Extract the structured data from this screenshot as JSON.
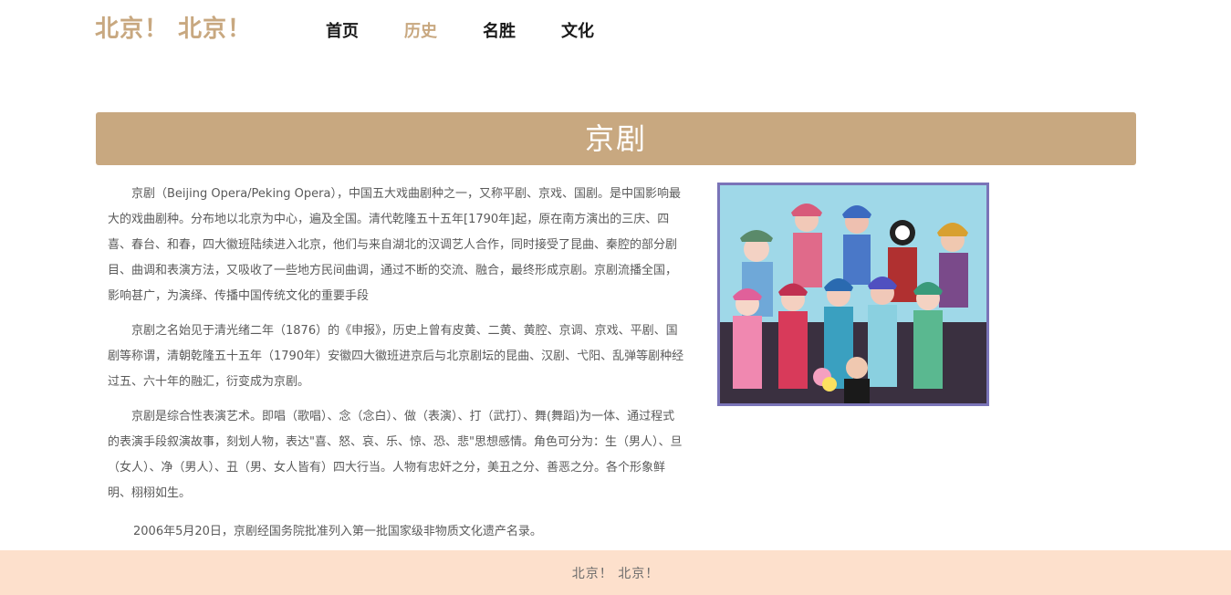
{
  "header": {
    "logo": "北京！ 北京！",
    "nav": [
      {
        "label": "首页",
        "active": false
      },
      {
        "label": "历史",
        "active": true
      },
      {
        "label": "名胜",
        "active": false
      },
      {
        "label": "文化",
        "active": false
      }
    ]
  },
  "main": {
    "title": "京剧",
    "paragraphs": [
      "京剧（Beijing Opera/Peking Opera），中国五大戏曲剧种之一，又称平剧、京戏、国剧。是中国影响最大的戏曲剧种。分布地以北京为中心，遍及全国。清代乾隆五十五年[1790年]起，原在南方演出的三庆、四喜、春台、和春，四大徽班陆续进入北京，他们与来自湖北的汉调艺人合作，同时接受了昆曲、秦腔的部分剧目、曲调和表演方法，又吸收了一些地方民间曲调，通过不断的交流、融合，最终形成京剧。京剧流播全国，影响甚广，为演绎、传播中国传统文化的重要手段",
      "京剧之名始见于清光绪二年（1876）的《申报》，历史上曾有皮黄、二黄、黄腔、京调、京戏、平剧、国剧等称谓，清朝乾隆五十五年（1790年）安徽四大徽班进京后与北京剧坛的昆曲、汉剧、弋阳、乱弹等剧种经过五、六十年的融汇，衍变成为京剧。",
      "京剧是综合性表演艺术。即唱（歌唱）、念（念白）、做（表演）、打（武打）、舞(舞蹈)为一体、通过程式的表演手段叙演故事，刻划人物，表达\"喜、怒、哀、乐、惊、恐、悲\"思想感情。角色可分为：生（男人）、旦（女人）、净（男人）、丑（男、女人皆有）四大行当。人物有忠奸之分，美丑之分、善恶之分。各个形象鲜明、栩栩如生。",
      "2006年5月20日，京剧经国务院批准列入第一批国家级非物质文化遗产名录。"
    ]
  },
  "footer": {
    "text": "北京！ 北京！"
  },
  "colors": {
    "accent": "#c8a880",
    "footer_bg": "#fde0cc",
    "text": "#5a5a5a",
    "photo_border": "#7a74b8"
  }
}
